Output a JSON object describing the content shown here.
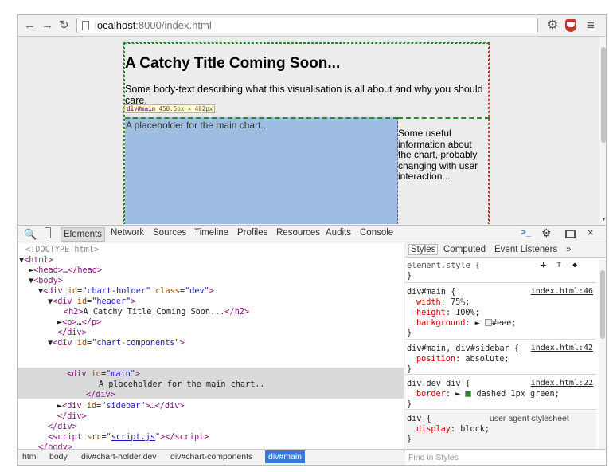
{
  "browser": {
    "url_host": "localhost",
    "url_path": ":8000/index.html"
  },
  "page": {
    "title": "A Catchy Title Coming Soon...",
    "lead": "Some body-text describing what this visualisation is all about and why you should care.",
    "chart_placeholder": "A placeholder for the main chart..",
    "sidebar_text": "Some useful information about the chart, probably changing with user interaction...",
    "tooltip_selector": "div#main",
    "tooltip_w": "450.5",
    "tooltip_h": "402",
    "tooltip_unit": "px",
    "tooltip_x": "×"
  },
  "devtools": {
    "tabs": [
      "Elements",
      "Network",
      "Sources",
      "Timeline",
      "Profiles",
      "Resources",
      "Audits",
      "Console"
    ],
    "active_tab": "Elements",
    "dom": {
      "doctype": "<!DOCTYPE html>",
      "html_open": "<html>",
      "head": "<head>…</head>",
      "body_open": "<body>",
      "chart_holder_id": "\"chart-holder\"",
      "chart_holder_class": "\"dev\"",
      "header_id": "\"header\"",
      "h2_text": "A Catchy Title Coming Soon...",
      "p": "<p>…</p>",
      "div_close": "</div>",
      "chart_components_id": "\"chart-components\"",
      "main_id": "\"main\"",
      "main_text": "A placeholder for the main chart..",
      "sidebar_id": "\"sidebar\"",
      "script_src": "script.js",
      "body_close": "</body>",
      "html_close": "</html>"
    },
    "styles_tabs": [
      "Styles",
      "Computed",
      "Event Listeners",
      "»"
    ],
    "rules": [
      {
        "selector": "element.style {",
        "decls": [],
        "source": ""
      },
      {
        "selector": "div#main {",
        "decls": [
          {
            "p": "width",
            "v": "75%;"
          },
          {
            "p": "height",
            "v": "100%;"
          },
          {
            "p": "background",
            "v": "#eee;"
          }
        ],
        "source": "index.html:46"
      },
      {
        "selector": "div#main, div#sidebar {",
        "decls": [
          {
            "p": "position",
            "v": "absolute;"
          }
        ],
        "source": "index.html:42"
      },
      {
        "selector": "div.dev div {",
        "decls": [
          {
            "p": "border",
            "v": "dashed 1px green;"
          }
        ],
        "source": "index.html:22"
      },
      {
        "selector": "div {",
        "decls": [
          {
            "p": "display",
            "v": "block;"
          }
        ],
        "source": "user agent stylesheet"
      }
    ],
    "breadcrumbs": [
      "html",
      "body",
      "div#chart-holder.dev",
      "div#chart-components",
      "div#main"
    ],
    "find_placeholder": "Find in Styles",
    "colors": {
      "green_swatch": "#1a8a1a",
      "eee_swatch": "#eeeeee",
      "selection": "#3879d9"
    }
  }
}
